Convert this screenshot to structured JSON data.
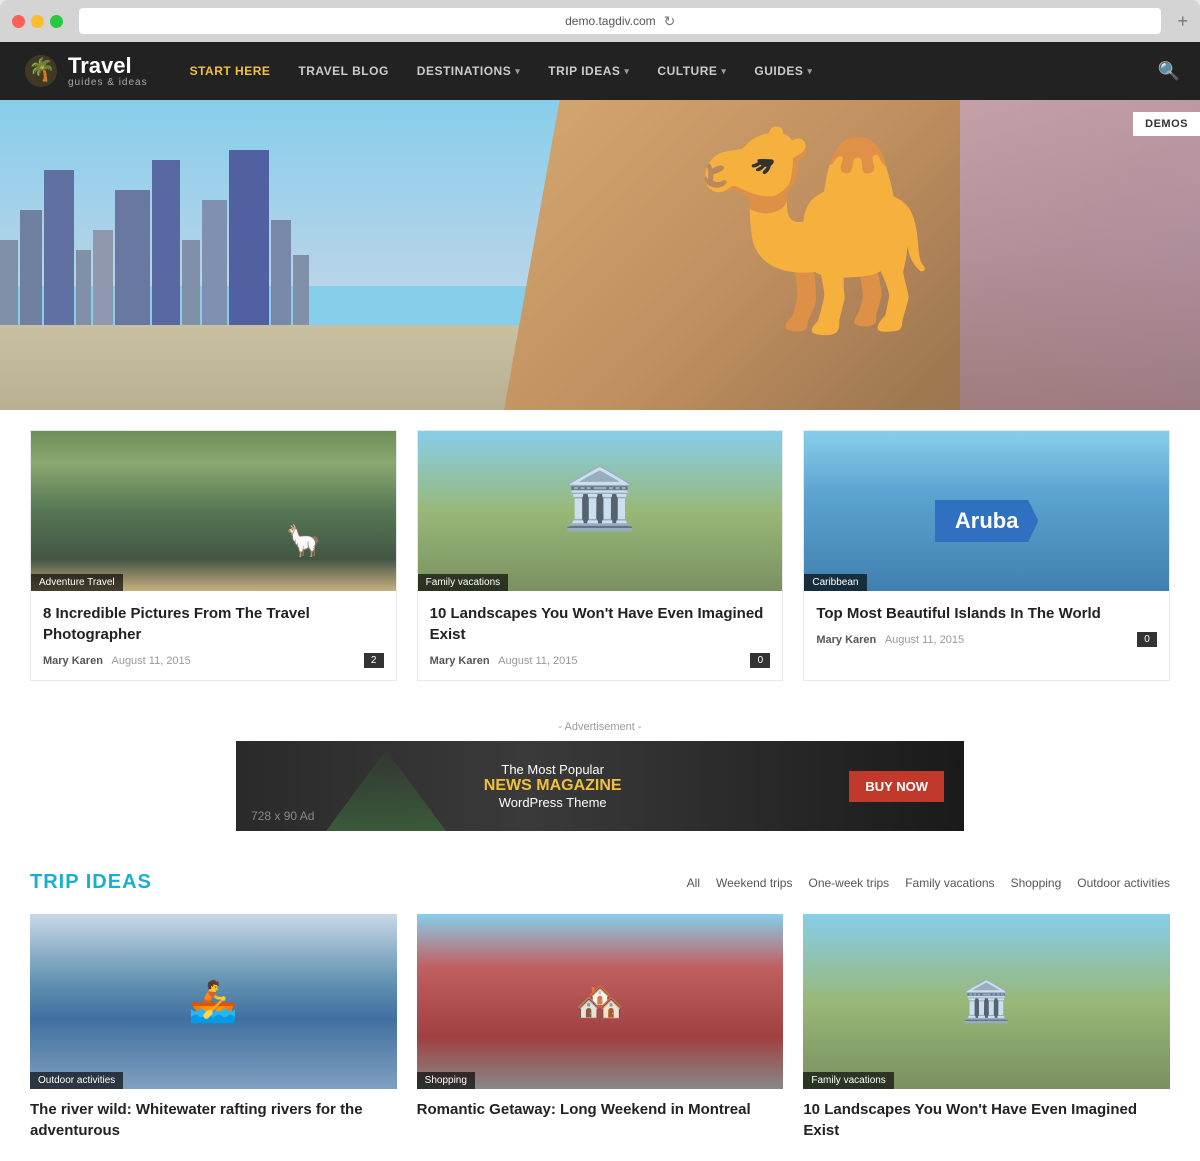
{
  "browser": {
    "url": "demo.tagdiv.com"
  },
  "nav": {
    "logo_main": "Travel",
    "logo_sub": "guides & ideas",
    "links": [
      {
        "label": "START HERE",
        "active": true
      },
      {
        "label": "TRAVEL BLOG",
        "active": false
      },
      {
        "label": "DESTINATIONS",
        "has_dropdown": true,
        "active": false
      },
      {
        "label": "TRIP IDEAS",
        "has_dropdown": true,
        "active": false
      },
      {
        "label": "CULTURE",
        "has_dropdown": true,
        "active": false
      },
      {
        "label": "GUIDES",
        "has_dropdown": true,
        "active": false
      }
    ]
  },
  "demos_button": "DEMOS",
  "articles": [
    {
      "category": "Adventure Travel",
      "title": "8 Incredible Pictures From The Travel Photographer",
      "author": "Mary Karen",
      "date": "August 11, 2015",
      "count": "2"
    },
    {
      "category": "Family vacations",
      "title": "10 Landscapes You Won't Have Even Imagined Exist",
      "author": "Mary Karen",
      "date": "August 11, 2015",
      "count": "0"
    },
    {
      "category": "Caribbean",
      "title": "Top Most Beautiful Islands In The World",
      "author": "Mary Karen",
      "date": "August 11, 2015",
      "count": "0"
    }
  ],
  "advertisement": {
    "label": "- Advertisement -",
    "size_label": "728 x 90 Ad",
    "tagline_part1": "The Most Popular",
    "tagline_accent": "NEWS MAGAZINE",
    "tagline_part2": "WordPress Theme",
    "button_label": "BUY NOW"
  },
  "trip_ideas": {
    "section_title": "TRIP IDEAS",
    "filters": [
      "All",
      "Weekend trips",
      "One-week trips",
      "Family vacations",
      "Shopping",
      "Outdoor activities"
    ],
    "cards": [
      {
        "category": "Outdoor activities",
        "title": "The river wild: Whitewater rafting rivers for the adventurous"
      },
      {
        "category": "Shopping",
        "title": "Romantic Getaway: Long Weekend in Montreal"
      },
      {
        "category": "Family vacations",
        "title": "10 Landscapes You Won't Have Even Imagined Exist"
      }
    ]
  }
}
